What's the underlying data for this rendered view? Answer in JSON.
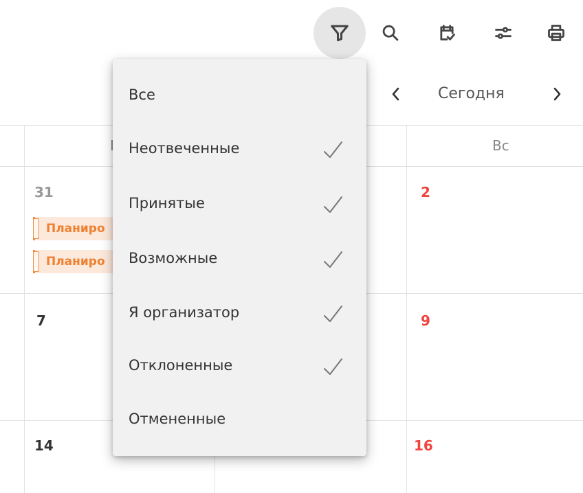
{
  "toolbar": {
    "icons": [
      "filter-icon",
      "search-icon",
      "calendar-check-icon",
      "sliders-icon",
      "print-icon"
    ],
    "active": "filter-icon"
  },
  "nav": {
    "today_label": "Сегодня"
  },
  "calendar": {
    "headers": {
      "col2": "П",
      "col4": "Вс"
    },
    "rows": [
      {
        "col1": "31",
        "col3": "2"
      },
      {
        "col1": "7",
        "col3": "9"
      },
      {
        "col1": "14",
        "col3": "16"
      }
    ],
    "events": [
      "Планиро",
      "Планиро"
    ],
    "colors": {
      "weekend": "#f0443f",
      "event_accent": "#f08a3c",
      "event_bg": "#fde9dc"
    }
  },
  "filter_menu": {
    "items": [
      {
        "label": "Все",
        "checked": false
      },
      {
        "label": "Неотвеченные",
        "checked": true
      },
      {
        "label": "Принятые",
        "checked": true
      },
      {
        "label": "Возможные",
        "checked": true
      },
      {
        "label": "Я организатор",
        "checked": true
      },
      {
        "label": "Отклоненные",
        "checked": true
      },
      {
        "label": "Отмененные",
        "checked": false
      }
    ]
  }
}
